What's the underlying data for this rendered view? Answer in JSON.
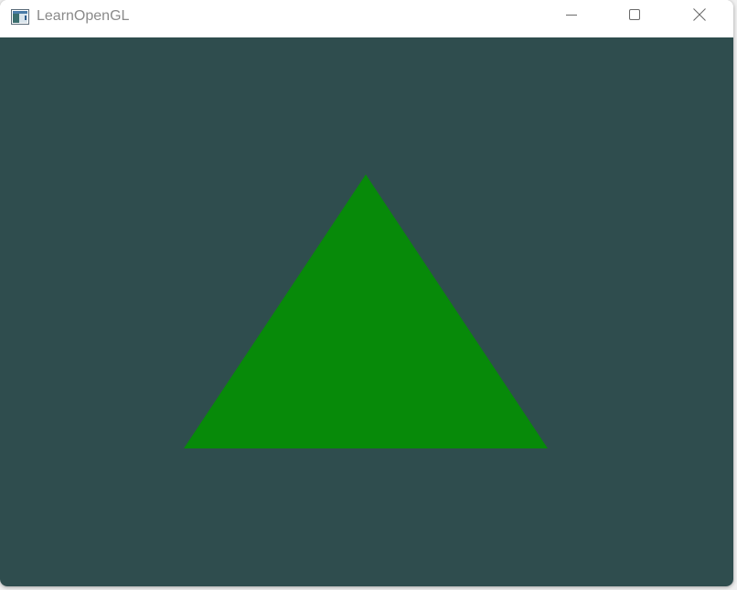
{
  "window": {
    "title": "LearnOpenGL",
    "icon": "opengl-window-icon"
  },
  "caption_buttons": {
    "minimize_icon": "minimize-icon",
    "maximize_icon": "maximize-icon",
    "close_icon": "close-icon"
  },
  "scene": {
    "clear_color": "#2f4d4e",
    "triangle_color": "#078a09"
  },
  "colors": {
    "titlebar_bg": "#ffffff",
    "title_text": "#8a8a8a",
    "caption_glyph": "#6a6a6a"
  }
}
